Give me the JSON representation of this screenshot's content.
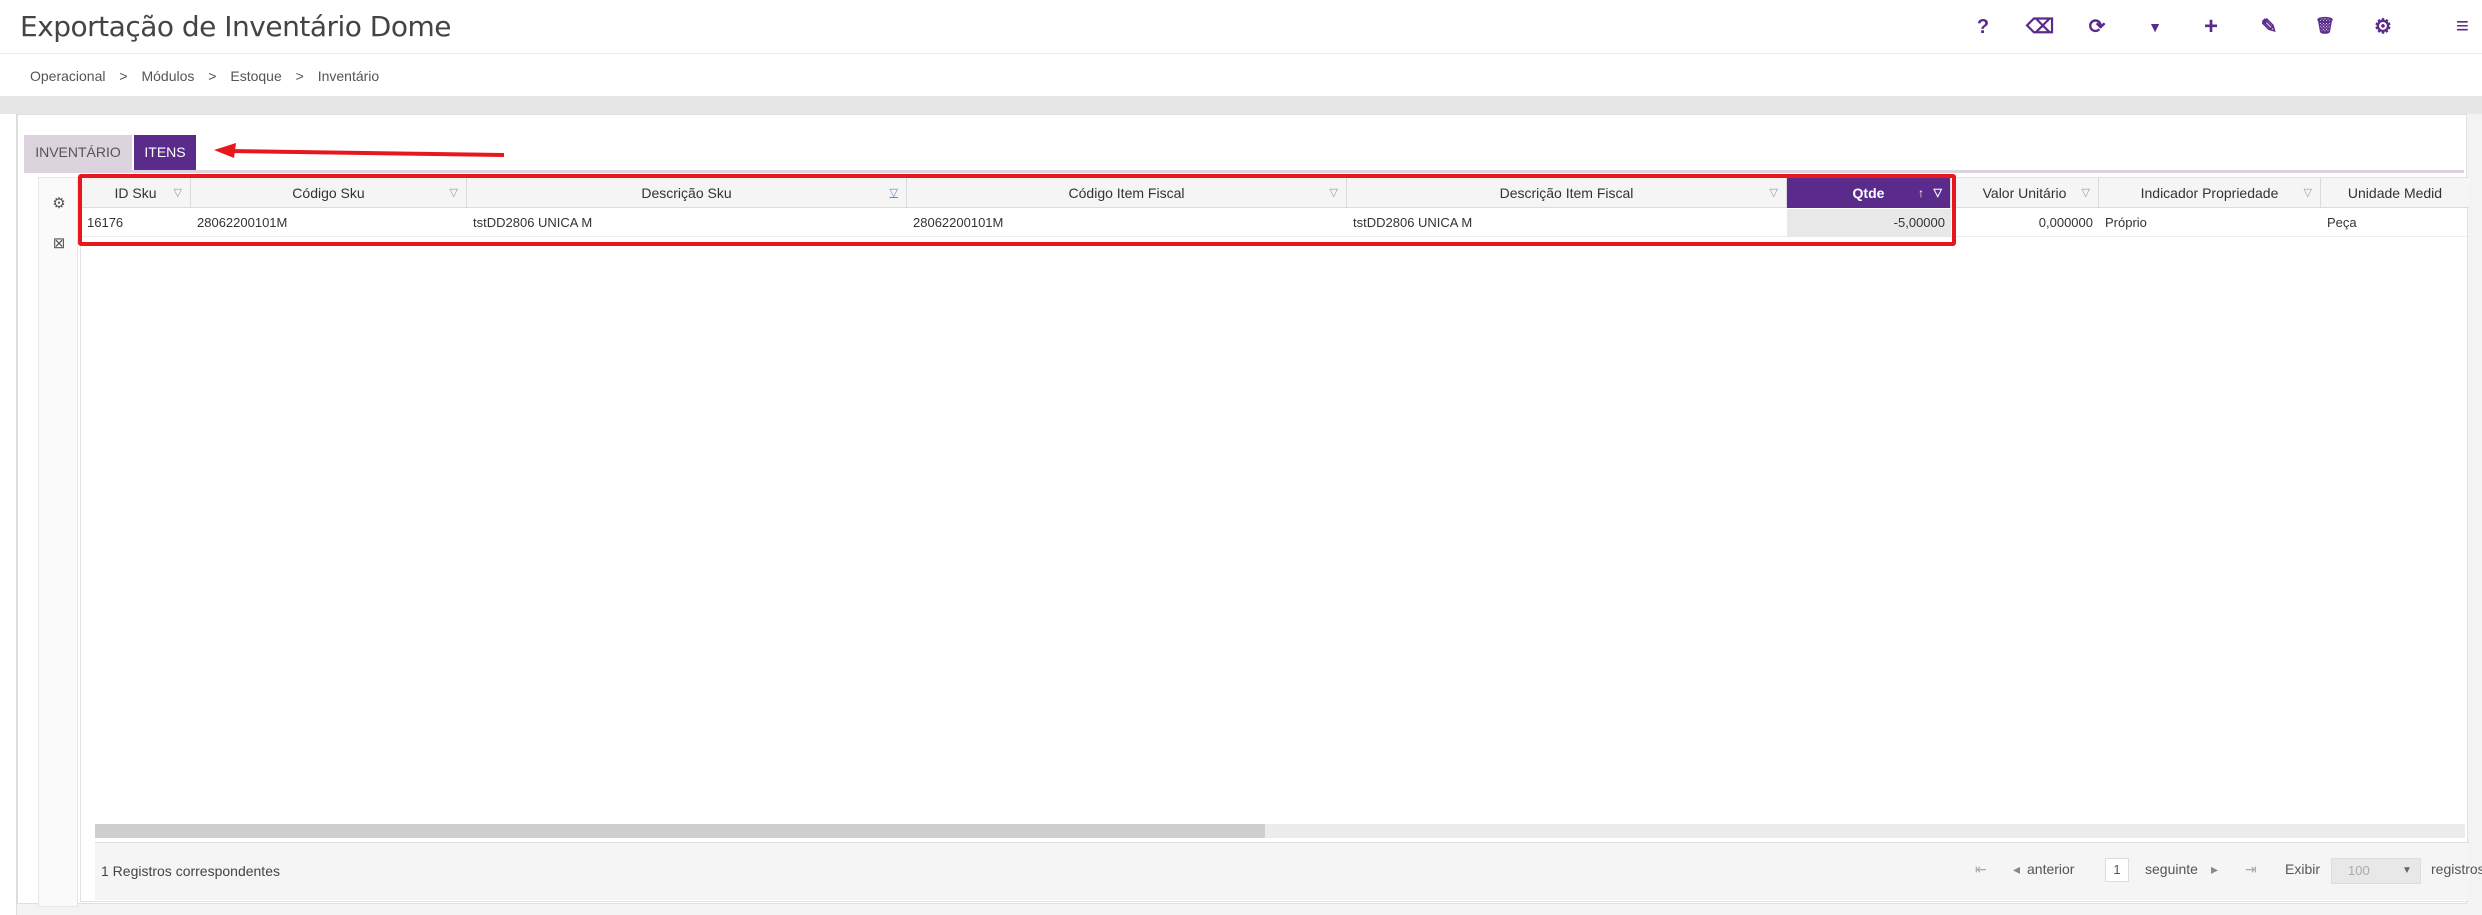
{
  "header": {
    "title": "Exportação de Inventário Dome",
    "toolbar_icons": [
      "help-icon",
      "eraser-icon",
      "refresh-icon",
      "filter-icon",
      "add-icon",
      "edit-icon",
      "delete-icon",
      "settings-icon",
      "menu-icon"
    ],
    "glyphs": {
      "help": "?",
      "eraser": "⌫",
      "refresh": "⟳",
      "filter": "▼",
      "add": "+",
      "edit": "✎",
      "delete": "🗑",
      "settings": "⚙",
      "menu": "≡"
    }
  },
  "breadcrumb": [
    "Operacional",
    ">",
    "Módulos",
    ">",
    "Estoque",
    ">",
    "Inventário"
  ],
  "tabs": [
    {
      "label": "INVENTÁRIO",
      "active": false
    },
    {
      "label": "ITENS",
      "active": true
    }
  ],
  "sidebar": {
    "icons": [
      "gears-icon",
      "excel-export-icon"
    ],
    "glyphs": [
      "⚙",
      "⊠"
    ]
  },
  "grid": {
    "columns": [
      {
        "label": "ID Sku"
      },
      {
        "label": "Código Sku"
      },
      {
        "label": "Descrição Sku"
      },
      {
        "label": "Código Item Fiscal"
      },
      {
        "label": "Descrição Item Fiscal"
      },
      {
        "label": "Qtde",
        "active": true
      },
      {
        "label": "Valor Unitário"
      },
      {
        "label": "Indicador Propriedade"
      },
      {
        "label": "Unidade Medid"
      }
    ],
    "rows": [
      [
        "16176",
        "28062200101M",
        "tstDD2806 UNICA M",
        "28062200101M",
        "tstDD2806 UNICA M",
        "-5,00000",
        "0,000000",
        "Próprio",
        "Peça"
      ]
    ]
  },
  "footer": {
    "count_text": "1 Registros correspondentes",
    "prev_label": "anterior",
    "page": "1",
    "next_label": "seguinte",
    "show_label": "Exibir",
    "show_value": "100",
    "records_label": "registros"
  },
  "colors": {
    "accent": "#5b2b8c",
    "highlight": "#e8171d"
  }
}
